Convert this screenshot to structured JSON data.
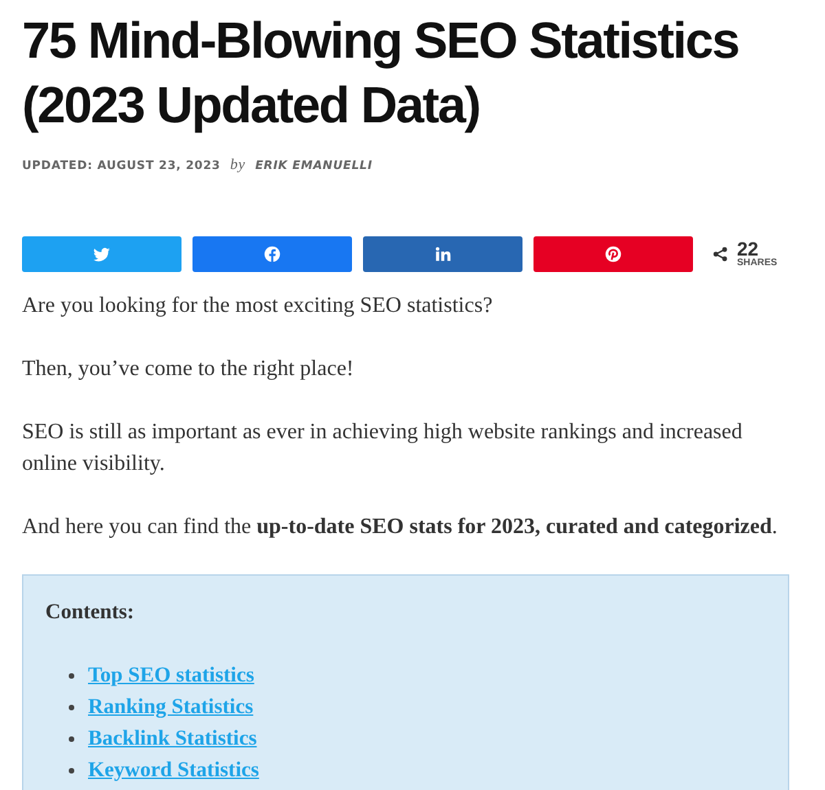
{
  "article": {
    "title": "75 Mind-Blowing SEO Statistics (2023 Updated Data)",
    "updated": "UPDATED: AUGUST 23, 2023",
    "by": "by",
    "author": "ERIK EMANUELLI"
  },
  "share_buttons": [
    {
      "kind": "twitter",
      "color": "#1da1f2"
    },
    {
      "kind": "facebook",
      "color": "#1877f2"
    },
    {
      "kind": "linkedin",
      "color": "#2867b2"
    },
    {
      "kind": "pinterest",
      "color": "#e60023"
    }
  ],
  "share_count": {
    "count": "22",
    "label": "SHARES"
  },
  "paragraphs": [
    "Are you looking for the most exciting SEO statistics?",
    "Then, you’ve come to the right place!",
    "SEO is still as important as ever in achieving high website rankings and increased online visibility.",
    "And here you can find the **up-to-date SEO stats for 2023, curated and categorized**."
  ],
  "contents": {
    "heading": "Contents:",
    "items": [
      "Top SEO statistics",
      "Ranking Statistics",
      "Backlink Statistics",
      "Keyword Statistics"
    ]
  }
}
